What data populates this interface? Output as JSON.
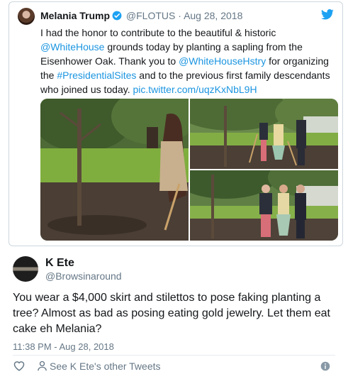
{
  "quoted_tweet": {
    "author_name": "Melania Trump",
    "author_handle": "@FLOTUS",
    "separator": "·",
    "date": "Aug 28, 2018",
    "text": {
      "part1": "I had the honor to contribute to the beautiful & historic ",
      "mention1": "@WhiteHouse",
      "part2": " grounds today by planting a sapling from the Eisenhower Oak.  Thank you to ",
      "mention2": "@WhiteHouseHstry",
      "part3": " for organizing the ",
      "hashtag": "#PresidentialSites",
      "part4": " and to the previous first family descendants who joined us today. ",
      "pic_link": "pic.twitter.com/uqzKxNbL9H"
    },
    "icons": [
      "verified-badge-icon",
      "twitter-bird-icon"
    ],
    "photos": [
      "photo-planting-closeup",
      "photo-group-shoveling",
      "photo-group-posing"
    ]
  },
  "reply_tweet": {
    "author_name": "K Ete",
    "author_handle": "@Browsinaround",
    "text": "You wear a $4,000 skirt and stilettos to pose faking planting a tree? Almost as bad as posing eating gold jewelry. Let them eat cake eh Melania?",
    "timestamp": "11:38 PM - Aug 28, 2018",
    "other_tweets_label": "See K Ete's other Tweets",
    "icons": [
      "heart-icon",
      "person-icon",
      "info-icon"
    ]
  },
  "colors": {
    "link": "#1b95e0",
    "muted": "#657786",
    "text": "#14171a",
    "border": "#ccd6dd"
  }
}
